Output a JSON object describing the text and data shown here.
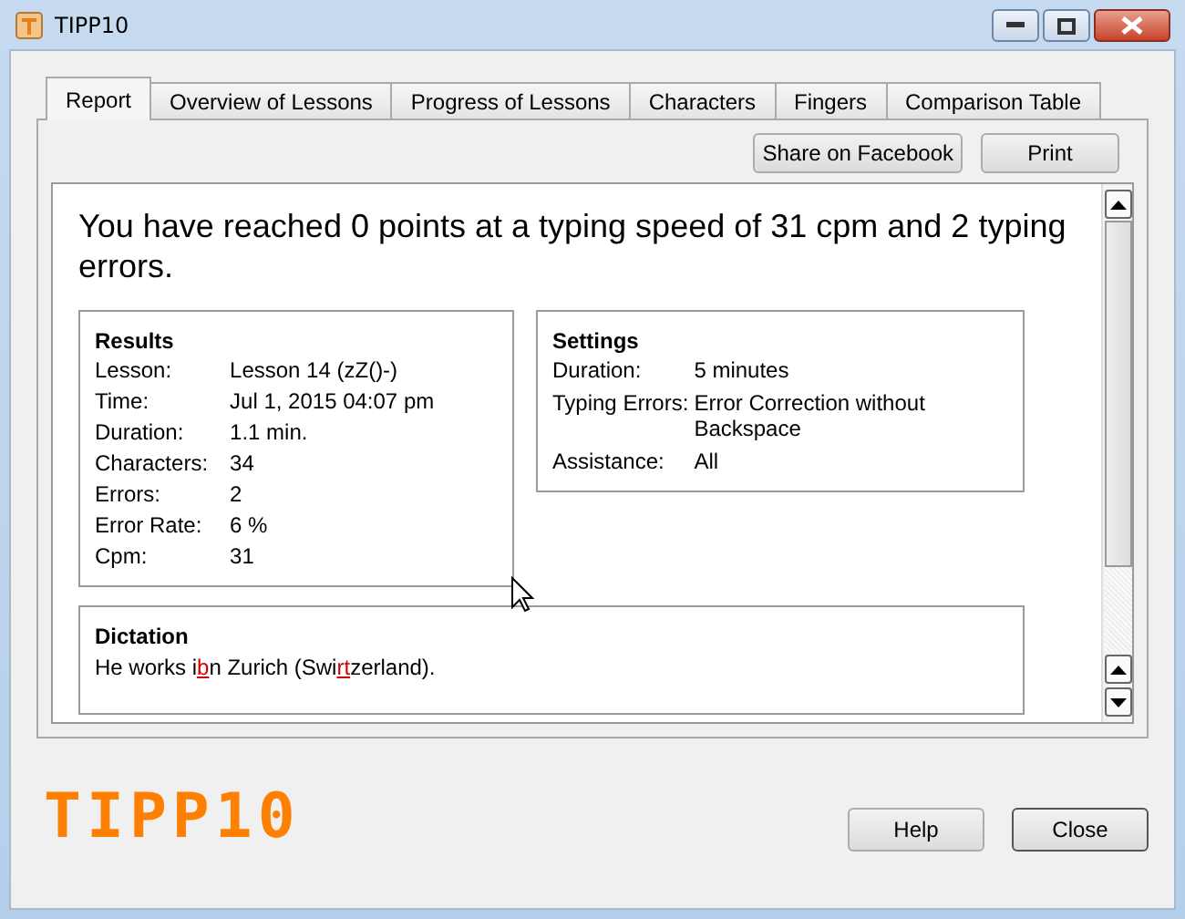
{
  "window": {
    "title": "TIPP10"
  },
  "tabs": [
    {
      "label": "Report",
      "selected": true
    },
    {
      "label": "Overview of Lessons",
      "selected": false
    },
    {
      "label": "Progress of Lessons",
      "selected": false
    },
    {
      "label": "Characters",
      "selected": false
    },
    {
      "label": "Fingers",
      "selected": false
    },
    {
      "label": "Comparison Table",
      "selected": false
    }
  ],
  "toolbar_buttons": [
    "Share on Facebook",
    "Print"
  ],
  "report": {
    "headline": "You have reached 0 points at a typing speed of 31 cpm and 2 typing errors.",
    "results": {
      "title": "Results",
      "rows": [
        {
          "label": "Lesson:",
          "value": "Lesson 14 (zZ()-)"
        },
        {
          "label": "Time:",
          "value": "Jul 1, 2015 04:07 pm"
        },
        {
          "label": "Duration:",
          "value": "1.1 min."
        },
        {
          "label": "Characters:",
          "value": "34"
        },
        {
          "label": "Errors:",
          "value": "2"
        },
        {
          "label": "Error Rate:",
          "value": "6 %"
        },
        {
          "label": "Cpm:",
          "value": "31"
        }
      ]
    },
    "settings": {
      "title": "Settings",
      "rows": [
        {
          "label": "Duration:",
          "value": "5 minutes"
        },
        {
          "label": "Typing Errors:",
          "value": "Error Correction without Backspace"
        },
        {
          "label": "Assistance:",
          "value": "All"
        }
      ]
    },
    "dictation": {
      "title": "Dictation",
      "segments": [
        {
          "text": "He works i",
          "error": false
        },
        {
          "text": "b",
          "error": true
        },
        {
          "text": "n Zurich (Swi",
          "error": false
        },
        {
          "text": "rt",
          "error": true
        },
        {
          "text": "zerland).",
          "error": false
        }
      ]
    }
  },
  "logo": "TIPP10",
  "footer_buttons": [
    "Help",
    "Close"
  ]
}
